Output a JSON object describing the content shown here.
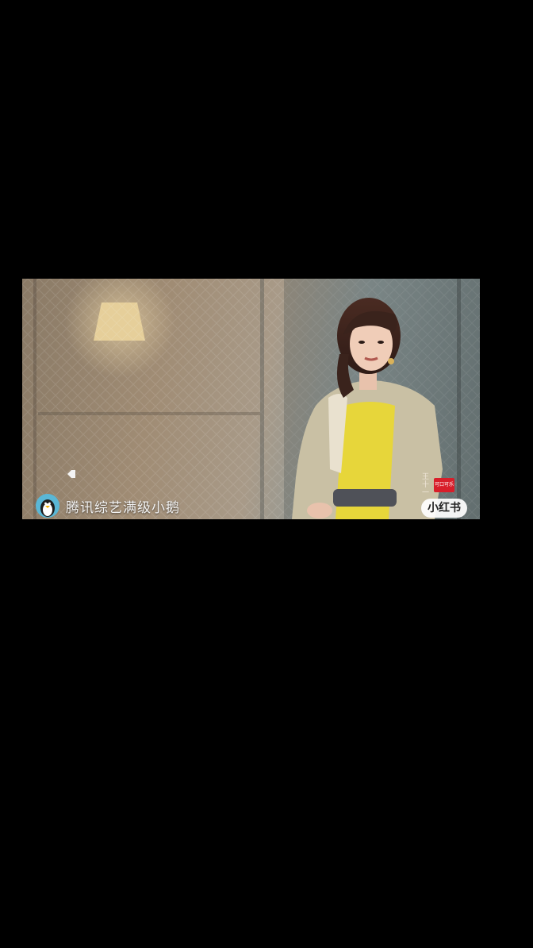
{
  "video": {
    "watermark_text": "腾讯综艺满级小鹅",
    "watermark_icon": "penguin-icon",
    "sponsor_badge": "小红书",
    "brand_side_text": "王十一",
    "brand_logo_text": "可口可乐",
    "overlay_icon": "tag-icon"
  },
  "colors": {
    "background": "#000000",
    "lamp": "#e6cf9a",
    "jacket": "#c9c0a4",
    "top": "#e7d63a",
    "sponsor_logo": "#d81e2a"
  }
}
